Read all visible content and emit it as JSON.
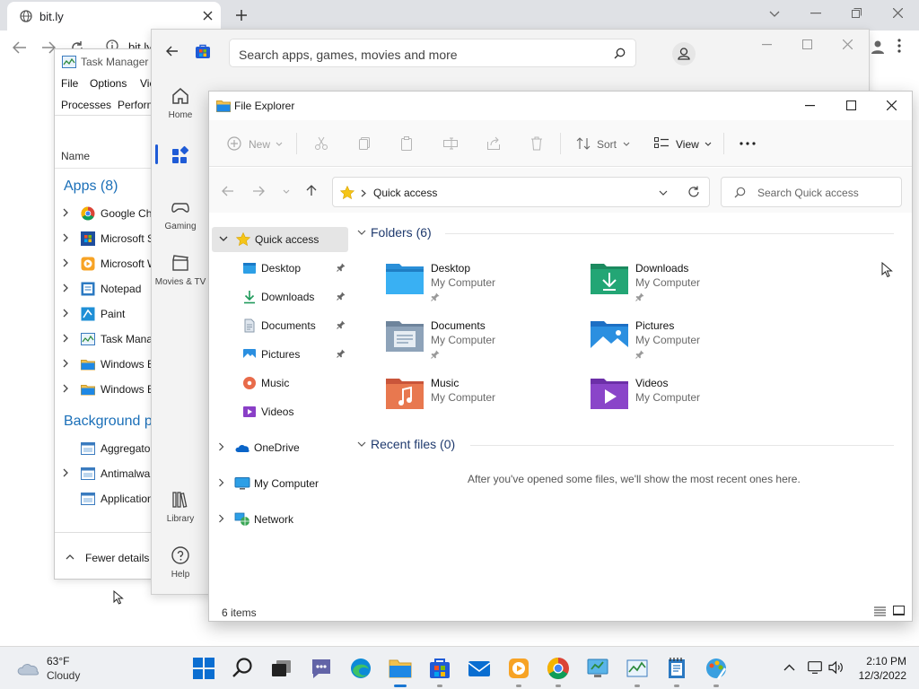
{
  "browser": {
    "tab_title": "bit.ly",
    "address": "bit.ly"
  },
  "task_manager": {
    "title": "Task Manager",
    "menu": [
      "File",
      "Options",
      "View"
    ],
    "tabs": [
      "Processes",
      "Performance"
    ],
    "column_name": "Name",
    "apps_group": "Apps (8)",
    "apps": [
      "Google Chrome",
      "Microsoft Store",
      "Microsoft Windows Media Player",
      "Notepad",
      "Paint",
      "Task Manager",
      "Windows Explorer",
      "Windows Explorer"
    ],
    "background_group": "Background processes",
    "background": [
      "Aggregator host",
      "Antimalware Service Executable",
      "Application Frame Host"
    ],
    "fewer_details": "Fewer details"
  },
  "store": {
    "search_placeholder": "Search apps, games, movies and more",
    "nav": [
      "Home",
      "",
      "Gaming",
      "Movies & TV",
      "Library",
      "Help"
    ]
  },
  "explorer": {
    "title": "File Explorer",
    "cmd": {
      "new": "New",
      "sort": "Sort",
      "view": "View"
    },
    "address": "Quick access",
    "search_placeholder": "Search Quick access",
    "nav": {
      "quick_access": "Quick access",
      "desktop": "Desktop",
      "downloads": "Downloads",
      "documents": "Documents",
      "pictures": "Pictures",
      "music": "Music",
      "videos": "Videos",
      "onedrive": "OneDrive",
      "my_computer": "My Computer",
      "network": "Network"
    },
    "folders_header": "Folders (6)",
    "folders": [
      {
        "name": "Desktop",
        "location": "My Computer",
        "pinned": true
      },
      {
        "name": "Downloads",
        "location": "My Computer",
        "pinned": true
      },
      {
        "name": "Documents",
        "location": "My Computer",
        "pinned": true
      },
      {
        "name": "Pictures",
        "location": "My Computer",
        "pinned": true
      },
      {
        "name": "Music",
        "location": "My Computer",
        "pinned": false
      },
      {
        "name": "Videos",
        "location": "My Computer",
        "pinned": false
      }
    ],
    "recent_header": "Recent files (0)",
    "recent_empty": "After you've opened some files, we'll show the most recent ones here.",
    "status": "6 items"
  },
  "taskbar": {
    "temperature": "63°F",
    "condition": "Cloudy",
    "time": "2:10 PM",
    "date": "12/3/2022"
  },
  "colors": {
    "accent": "#0067c0",
    "folder_yellow": "#f2c14e",
    "selection": "#e5e5e5"
  }
}
